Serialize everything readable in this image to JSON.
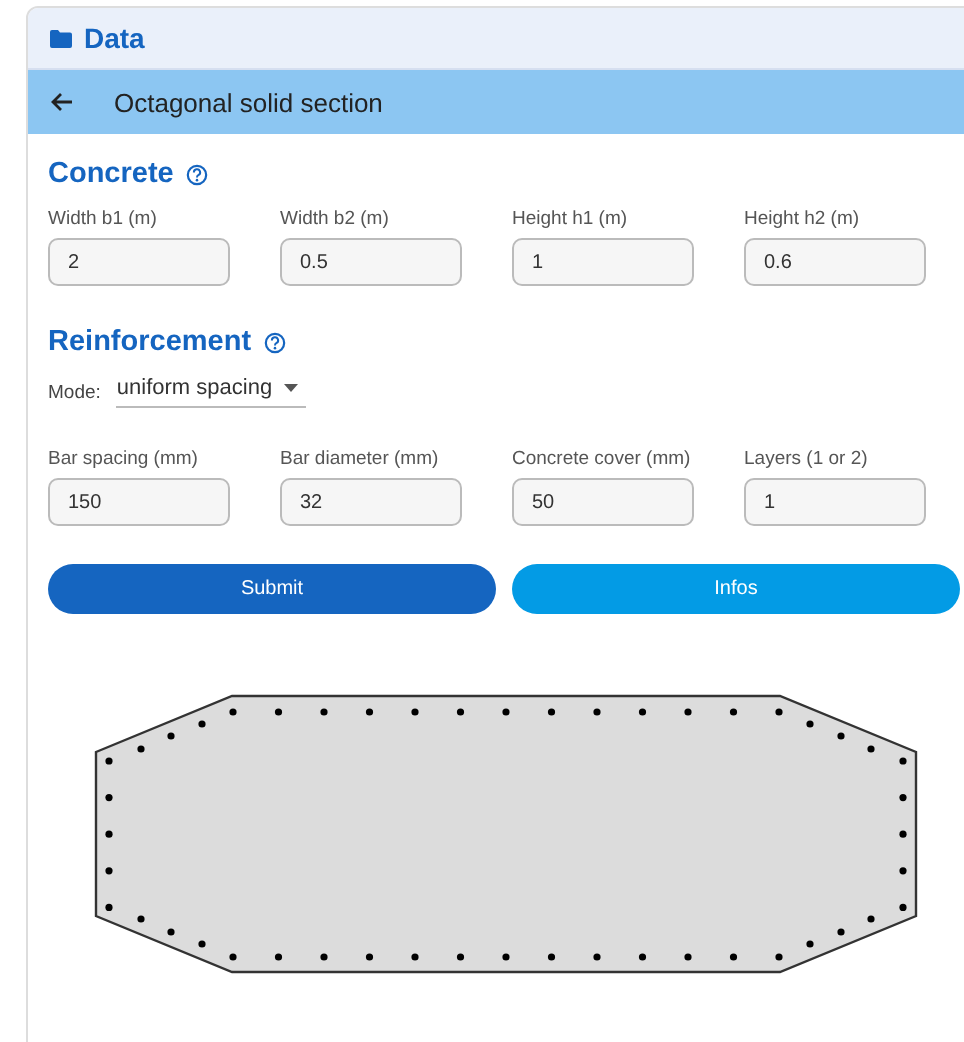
{
  "panel": {
    "title": "Data"
  },
  "subheader": {
    "title": "Octagonal solid section"
  },
  "concrete": {
    "heading": "Concrete",
    "fields": [
      {
        "label": "Width b1 (m)",
        "value": "2"
      },
      {
        "label": "Width b2 (m)",
        "value": "0.5"
      },
      {
        "label": "Height h1 (m)",
        "value": "1"
      },
      {
        "label": "Height h2 (m)",
        "value": "0.6"
      }
    ]
  },
  "reinforcement": {
    "heading": "Reinforcement",
    "mode": {
      "label": "Mode:",
      "value": "uniform spacing"
    },
    "fields": [
      {
        "label": "Bar spacing (mm)",
        "value": "150"
      },
      {
        "label": "Bar diameter (mm)",
        "value": "32"
      },
      {
        "label": "Concrete cover (mm)",
        "value": "50"
      },
      {
        "label": "Layers (1 or 2)",
        "value": "1"
      }
    ]
  },
  "buttons": [
    {
      "label": "Submit",
      "kind": "primary"
    },
    {
      "label": "Infos",
      "kind": "secondary"
    }
  ]
}
